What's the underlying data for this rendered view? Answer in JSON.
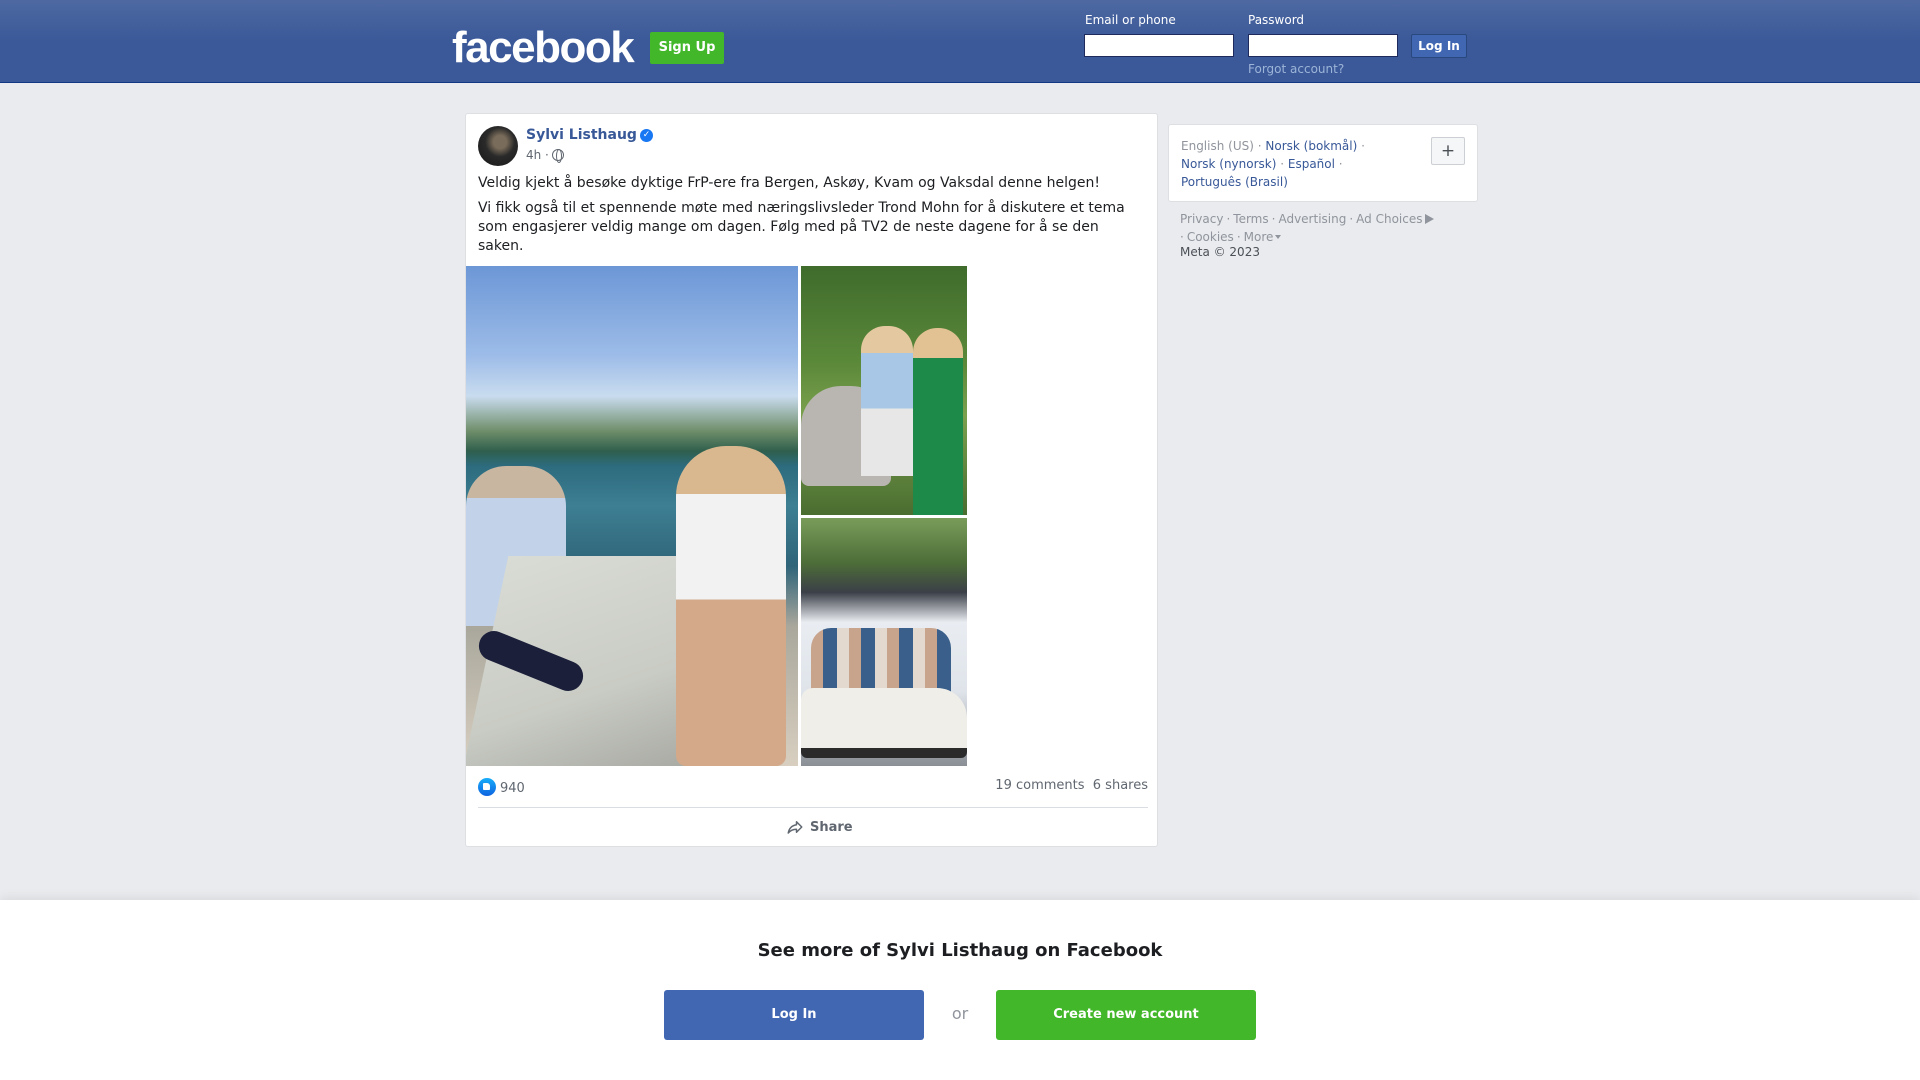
{
  "header": {
    "logo": "facebook",
    "signup_label": "Sign Up",
    "email_label": "Email or phone",
    "password_label": "Password",
    "login_label": "Log In",
    "forgot_label": "Forgot account?",
    "brand_color": "#3b5998",
    "green_color": "#42b72a"
  },
  "post": {
    "author": "Sylvi Listhaug",
    "verified": true,
    "time": "4h ·",
    "paragraph1": "Veldig kjekt å besøke dyktige FrP-ere fra Bergen, Askøy, Kvam og Vaksdal denne helgen!",
    "paragraph2": "Vi fikk også til et spennende møte med næringslivsleder Trond Mohn for å diskutere et tema som engasjerer veldig mange om dagen. Følg med på TV2 de neste dagene for å se den saken.",
    "likes": "940",
    "comments": "19 comments",
    "shares": "6 shares",
    "share_label": "Share",
    "photos": [
      "photo-lake-table",
      "photo-garden-stroller",
      "photo-house-car"
    ]
  },
  "sidebar": {
    "languages": {
      "current": "English (US)",
      "links": [
        "Norsk (bokmål)",
        "Norsk (nynorsk)",
        "Español",
        "Português (Brasil)"
      ],
      "plus_label": "+"
    },
    "footer": {
      "privacy": "Privacy",
      "terms": "Terms",
      "advertising": "Advertising",
      "ad_choices": "Ad Choices",
      "cookies": "Cookies",
      "more": "More",
      "copyright": "Meta © 2023"
    }
  },
  "overlay": {
    "title": "See more of Sylvi Listhaug on Facebook",
    "login_label": "Log In",
    "or_label": "or",
    "create_label": "Create new account"
  }
}
